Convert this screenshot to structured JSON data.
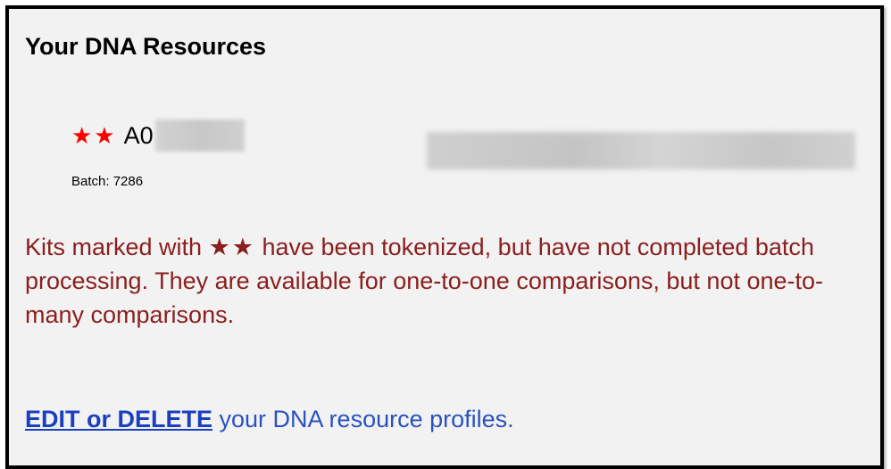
{
  "section": {
    "title": "Your DNA Resources"
  },
  "kit": {
    "marker": "★★",
    "id_prefix": "A0",
    "batch_label": "Batch: 7286"
  },
  "notice": {
    "before": "Kits marked with ",
    "marker": "★★",
    "after": " have been tokenized, but have not completed batch processing. They are available for one-to-one comparisons, but not one-to-many comparisons."
  },
  "edit": {
    "link_label": "EDIT or DELETE",
    "trailing_text": " your DNA resource profiles."
  },
  "colors": {
    "marker_red": "#ff0000",
    "notice_text": "#8b1e1e",
    "link_blue": "#1a3fc1",
    "panel_bg": "#f2f2f2"
  }
}
